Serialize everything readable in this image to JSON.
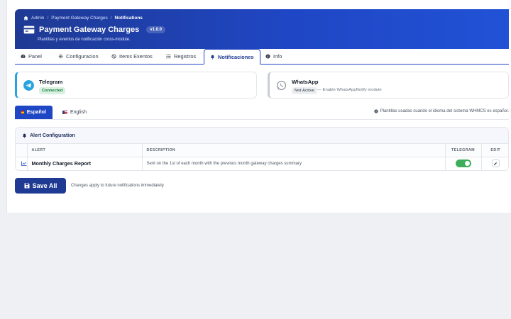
{
  "breadcrumb": {
    "items": [
      "Admin",
      "Payment Gateway Charges",
      "Notifications"
    ]
  },
  "header": {
    "title": "Payment Gateway Charges",
    "version": "v1.0.0",
    "subtitle": "Plantillas y eventos de notificación cross-module.",
    "colors": {
      "gradient_start": "#1f3a93",
      "gradient_end": "#2152d6"
    }
  },
  "tabs": [
    {
      "label": "Panel",
      "icon": "dashboard-icon",
      "active": false
    },
    {
      "label": "Configuracion",
      "icon": "gear-icon",
      "active": false
    },
    {
      "label": "Items Exentos",
      "icon": "ban-icon",
      "active": false
    },
    {
      "label": "Registros",
      "icon": "list-icon",
      "active": false
    },
    {
      "label": "Notificaciones",
      "icon": "bell-icon",
      "active": true
    },
    {
      "label": "Info",
      "icon": "info-icon",
      "active": false
    }
  ],
  "channels": {
    "telegram": {
      "name": "Telegram",
      "status": "Connected",
      "color": "#27a3e0"
    },
    "whatsapp": {
      "name": "WhatsApp",
      "status": "Not Active",
      "hint": "— Enable WhatsAppNotify module"
    }
  },
  "languages": {
    "items": [
      {
        "label": "Español",
        "active": true
      },
      {
        "label": "English",
        "active": false
      }
    ],
    "note": "Plantillas usadas cuando el idioma del sistema WHMCS es español."
  },
  "alerts": {
    "title": "Alert Configuration",
    "columns": [
      "ALERT",
      "DESCRIPTION",
      "TELEGRAM",
      "EDIT"
    ],
    "rows": [
      {
        "icon": "chart-icon",
        "name": "Monthly Charges Report",
        "description": "Sent on the 1st of each month with the previous month gateway charges summary",
        "telegram_enabled": true
      }
    ]
  },
  "footer": {
    "save_label": "Save All",
    "note": "Changes apply to future notifications immediately."
  },
  "colors": {
    "accent": "#1f46c4",
    "success": "#3fae5a"
  }
}
